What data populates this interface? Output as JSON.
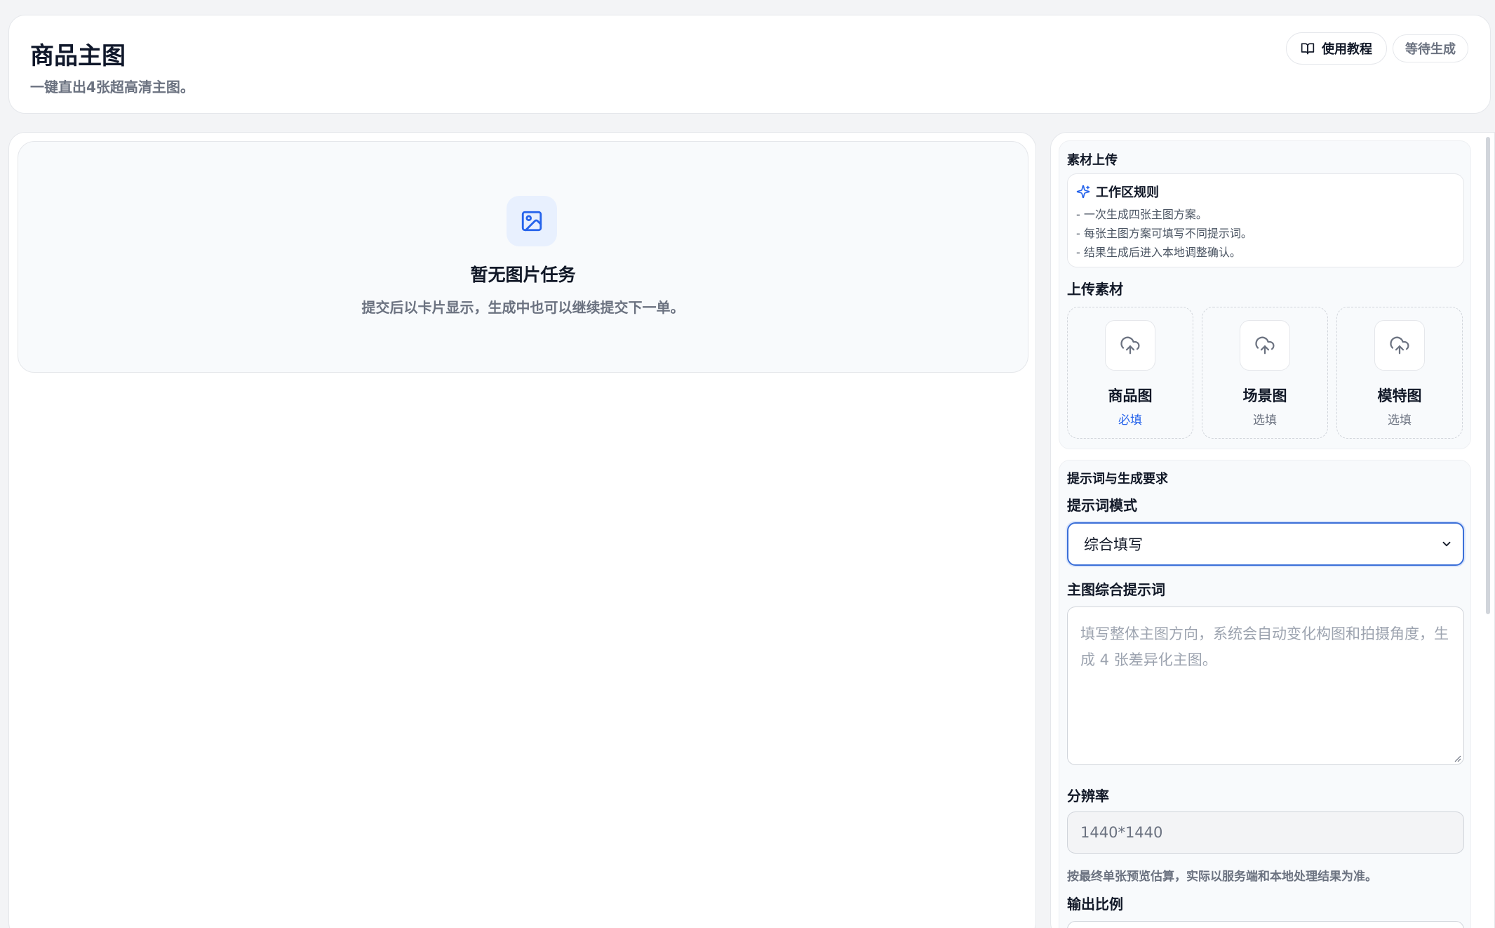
{
  "header": {
    "title": "商品主图",
    "subtitle": "一键直出4张超高清主图。",
    "tutorial_label": "使用教程",
    "status_label": "等待生成"
  },
  "empty_state": {
    "title": "暂无图片任务",
    "description": "提交后以卡片显示，生成中也可以继续提交下一单。"
  },
  "upload_section": {
    "title": "素材上传",
    "rules_title": "工作区规则",
    "rules": [
      "- 一次生成四张主图方案。",
      "- 每张主图方案可填写不同提示词。",
      "- 结果生成后进入本地调整确认。"
    ],
    "upload_label": "上传素材",
    "cards": [
      {
        "name": "商品图",
        "requirement": "必填"
      },
      {
        "name": "场景图",
        "requirement": "选填"
      },
      {
        "name": "模特图",
        "requirement": "选填"
      }
    ]
  },
  "prompt_section": {
    "title": "提示词与生成要求",
    "mode_label": "提示词模式",
    "mode_value": "综合填写",
    "prompt_label": "主图综合提示词",
    "prompt_placeholder": "填写整体主图方向，系统会自动变化构图和拍摄角度，生成 4 张差异化主图。",
    "resolution_label": "分辨率",
    "resolution_value": "1440*1440",
    "resolution_hint": "按最终单张预览估算，实际以服务端和本地处理结果为准。",
    "ratio_label": "输出比例"
  },
  "colors": {
    "accent": "#2563eb",
    "page_bg": "#f3f4f6",
    "muted_text": "#6b7280"
  }
}
